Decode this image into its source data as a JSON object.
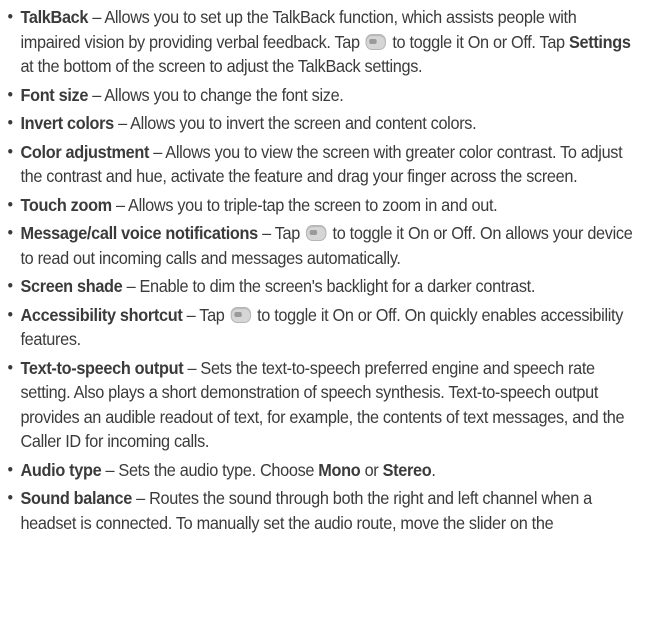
{
  "items": [
    {
      "term": "TalkBack",
      "t1": " – Allows you to set up the TalkBack function, which assists people with impaired vision by providing verbal feedback. Tap ",
      "t2": " to toggle it On or Off. Tap ",
      "bold2": "Settings",
      "t3": " at the bottom of the screen to adjust the TalkBack settings."
    },
    {
      "term": "Font size",
      "t1": " – Allows you to change the font size."
    },
    {
      "term": "Invert colors",
      "t1": " – Allows you to invert the screen and content colors."
    },
    {
      "term": "Color adjustment",
      "t1": " – Allows you to view the screen with greater color contrast. To adjust the contrast and hue, activate the feature and drag your finger across the screen."
    },
    {
      "term": "Touch zoom",
      "t1": " – Allows you to triple-tap the screen to zoom in and out."
    },
    {
      "term": "Message/call voice notifications",
      "t1": " – Tap ",
      "t2": " to toggle it On or Off. On allows your device to read out incoming calls and messages automatically."
    },
    {
      "term": "Screen shade",
      "t1": " – Enable to dim the screen's backlight for a darker contrast."
    },
    {
      "term": "Accessibility shortcut",
      "t1": " – Tap ",
      "t2": " to toggle it On or Off. On quickly enables accessibility features."
    },
    {
      "term": "Text-to-speech output",
      "t1": " – Sets the text-to-speech preferred engine and speech rate setting. Also plays a short demonstration of speech synthesis. Text-to-speech output provides an audible readout of text, for example, the contents of text messages, and the Caller ID for incoming calls."
    },
    {
      "term": "Audio type",
      "t1": " – Sets the audio type. Choose ",
      "bold1": "Mono",
      "t2": " or ",
      "bold2": "Stereo",
      "t3": "."
    },
    {
      "term": "Sound balance",
      "t1": " – Routes the sound through both the right and left channel when a headset is connected. To manually set the audio route, move the slider on the"
    }
  ],
  "bullet": "•",
  "icons": {
    "toggle": "toggle-off-icon"
  }
}
